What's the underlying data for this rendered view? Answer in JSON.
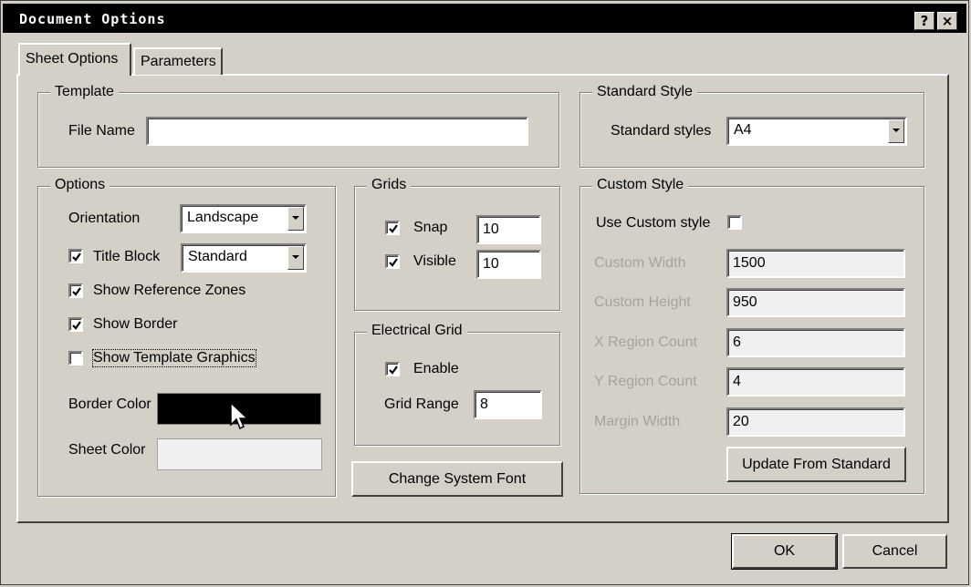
{
  "window": {
    "title": "Document Options",
    "help_label": "?",
    "close_label": "×"
  },
  "tabs": [
    {
      "label": "Sheet Options",
      "active": true
    },
    {
      "label": "Parameters",
      "active": false
    }
  ],
  "template": {
    "group_title": "Template",
    "file_name_label": "File Name",
    "file_name_value": ""
  },
  "standard_style": {
    "group_title": "Standard Style",
    "label": "Standard styles",
    "value": "A4"
  },
  "options": {
    "group_title": "Options",
    "orientation_label": "Orientation",
    "orientation_value": "Landscape",
    "title_block_label": "Title Block",
    "title_block_checked": true,
    "title_block_value": "Standard",
    "show_reference_zones_label": "Show Reference Zones",
    "show_reference_zones_checked": true,
    "show_border_label": "Show Border",
    "show_border_checked": true,
    "show_template_graphics_label": "Show Template Graphics",
    "show_template_graphics_checked": false,
    "border_color_label": "Border Color",
    "border_color": "#000000",
    "sheet_color_label": "Sheet Color",
    "sheet_color": "#f0f0f0"
  },
  "grids": {
    "group_title": "Grids",
    "snap_label": "Snap",
    "snap_checked": true,
    "snap_value": "10",
    "visible_label": "Visible",
    "visible_checked": true,
    "visible_value": "10"
  },
  "electrical_grid": {
    "group_title": "Electrical Grid",
    "enable_label": "Enable",
    "enable_checked": true,
    "grid_range_label": "Grid Range",
    "grid_range_value": "8"
  },
  "change_font_button": "Change System Font",
  "custom_style": {
    "group_title": "Custom Style",
    "use_custom_label": "Use Custom style",
    "use_custom_checked": false,
    "custom_width_label": "Custom Width",
    "custom_width_value": "1500",
    "custom_height_label": "Custom Height",
    "custom_height_value": "950",
    "x_region_label": "X Region Count",
    "x_region_value": "6",
    "y_region_label": "Y Region Count",
    "y_region_value": "4",
    "margin_width_label": "Margin Width",
    "margin_width_value": "20",
    "update_button": "Update From Standard"
  },
  "footer": {
    "ok_label": "OK",
    "cancel_label": "Cancel"
  },
  "icons": {
    "cursor": "mouse-pointer-icon",
    "check": "checkmark-icon"
  }
}
